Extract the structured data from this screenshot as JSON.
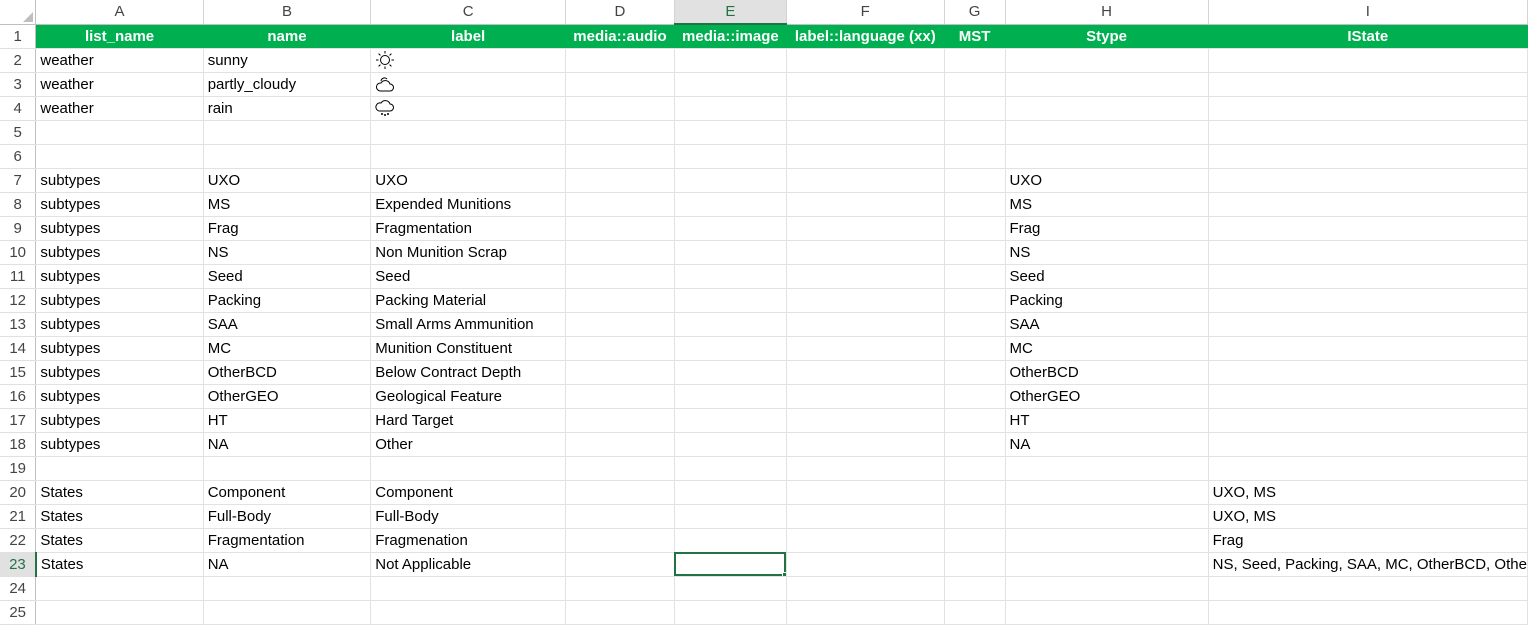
{
  "columns": [
    "A",
    "B",
    "C",
    "D",
    "E",
    "F",
    "G",
    "H",
    "I"
  ],
  "active_column": "E",
  "active_row": 23,
  "header": [
    "list_name",
    "name",
    "label",
    "media::audio",
    "media::image",
    "label::language (xx)",
    "MST",
    "Stype",
    "IState"
  ],
  "rows": [
    {
      "n": "2",
      "a": "weather",
      "b": "sunny",
      "c_icon": "sun-icon"
    },
    {
      "n": "3",
      "a": "weather",
      "b": "partly_cloudy",
      "c_icon": "partly-cloudy-icon"
    },
    {
      "n": "4",
      "a": "weather",
      "b": "rain",
      "c_icon": "rain-cloud-icon"
    },
    {
      "n": "5"
    },
    {
      "n": "6"
    },
    {
      "n": "7",
      "a": "subtypes",
      "b": "UXO",
      "c": "UXO",
      "h": "UXO"
    },
    {
      "n": "8",
      "a": "subtypes",
      "b": "MS",
      "c": "Expended Munitions",
      "h": "MS"
    },
    {
      "n": "9",
      "a": "subtypes",
      "b": "Frag",
      "c": "Fragmentation",
      "h": "Frag"
    },
    {
      "n": "10",
      "a": "subtypes",
      "b": "NS",
      "c": "Non Munition Scrap",
      "h": "NS"
    },
    {
      "n": "11",
      "a": "subtypes",
      "b": "Seed",
      "c": "Seed",
      "h": "Seed"
    },
    {
      "n": "12",
      "a": "subtypes",
      "b": "Packing",
      "c": "Packing Material",
      "h": "Packing"
    },
    {
      "n": "13",
      "a": "subtypes",
      "b": "SAA",
      "c": "Small Arms Ammunition",
      "h": "SAA"
    },
    {
      "n": "14",
      "a": "subtypes",
      "b": "MC",
      "c": "Munition Constituent",
      "h": "MC"
    },
    {
      "n": "15",
      "a": "subtypes",
      "b": "OtherBCD",
      "c": "Below Contract Depth",
      "h": "OtherBCD"
    },
    {
      "n": "16",
      "a": "subtypes",
      "b": "OtherGEO",
      "c": "Geological Feature",
      "h": "OtherGEO"
    },
    {
      "n": "17",
      "a": "subtypes",
      "b": "HT",
      "c": "Hard Target",
      "h": "HT"
    },
    {
      "n": "18",
      "a": "subtypes",
      "b": "NA",
      "c": "Other",
      "h": "NA"
    },
    {
      "n": "19"
    },
    {
      "n": "20",
      "a": "States",
      "b": "Component",
      "c": "Component",
      "i": "UXO, MS"
    },
    {
      "n": "21",
      "a": "States",
      "b": "Full-Body",
      "c": "Full-Body",
      "i": "UXO, MS"
    },
    {
      "n": "22",
      "a": "States",
      "b": "Fragmentation",
      "c": "Fragmenation",
      "i": "Frag"
    },
    {
      "n": "23",
      "a": "States",
      "b": "NA",
      "c": "Not Applicable",
      "i": "NS, Seed, Packing, SAA, MC, OtherBCD, Othe"
    },
    {
      "n": "24"
    },
    {
      "n": "25"
    }
  ],
  "colors": {
    "header_bg": "#00b050",
    "selection": "#217346"
  }
}
